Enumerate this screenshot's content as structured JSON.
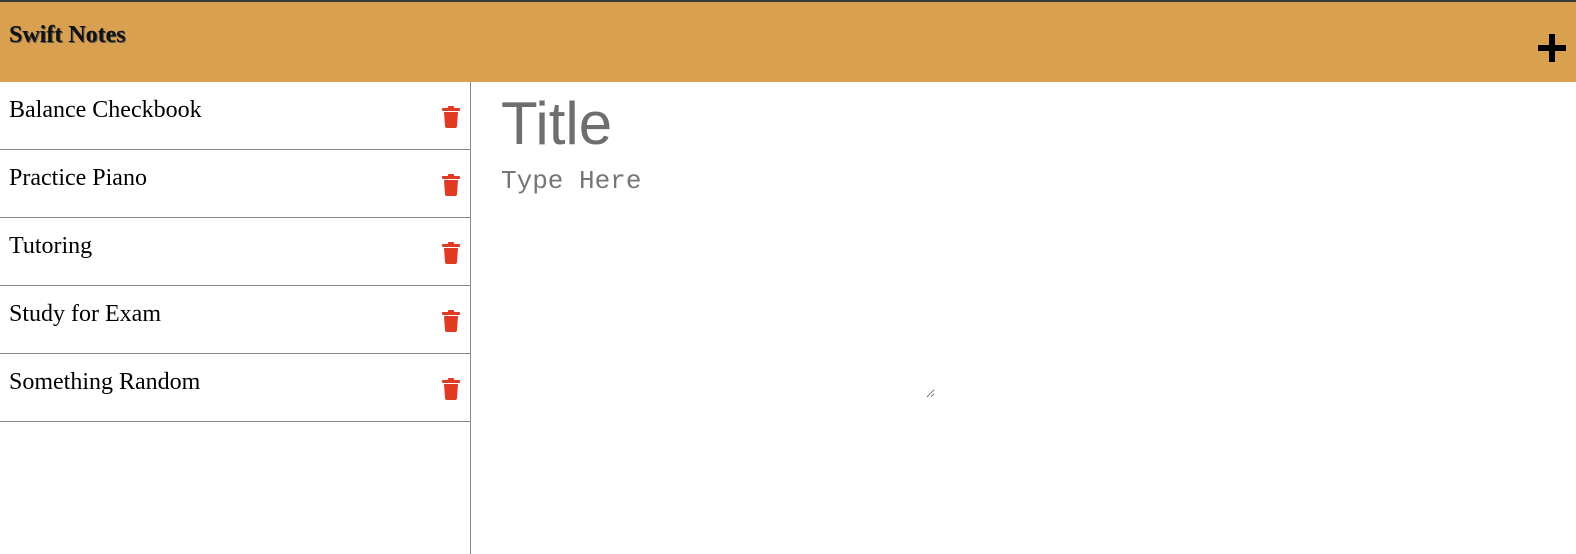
{
  "header": {
    "title": "Swift Notes",
    "add_icon": "plus-icon",
    "background_color": "#d9a04f"
  },
  "sidebar": {
    "items": [
      {
        "label": "Balance Checkbook",
        "delete_icon": "trash-icon"
      },
      {
        "label": "Practice Piano",
        "delete_icon": "trash-icon"
      },
      {
        "label": "Tutoring",
        "delete_icon": "trash-icon"
      },
      {
        "label": "Study for Exam",
        "delete_icon": "trash-icon"
      },
      {
        "label": "Something Random",
        "delete_icon": "trash-icon"
      }
    ],
    "delete_icon_color": "#e03a22"
  },
  "editor": {
    "title_placeholder": "Title",
    "title_value": "",
    "body_placeholder": "Type Here",
    "body_value": ""
  }
}
